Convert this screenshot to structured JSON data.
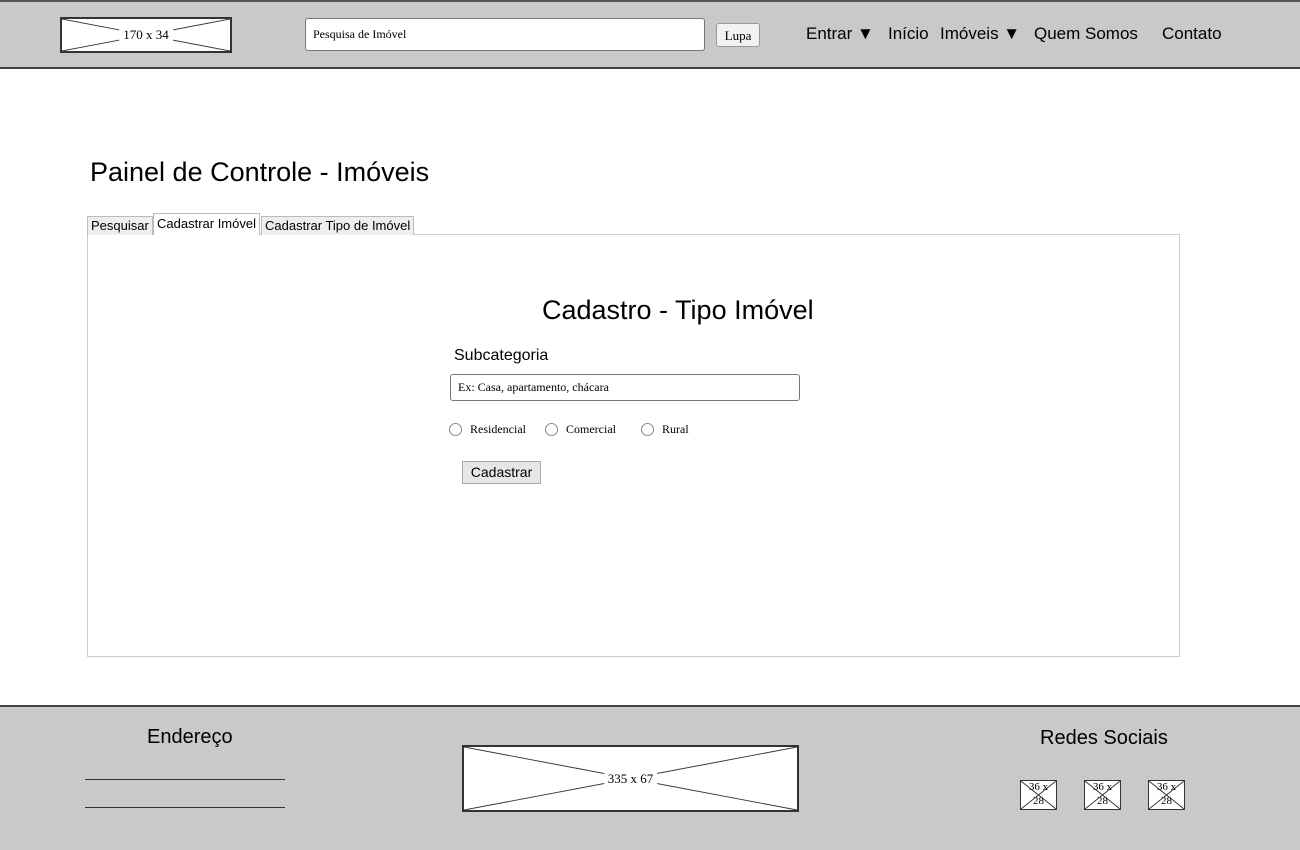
{
  "header": {
    "logo_placeholder": "170 x 34",
    "search": {
      "placeholder": "Pesquisa de Imóvel"
    },
    "search_button": "Lupa",
    "nav": {
      "entrar": "Entrar ▼",
      "inicio": "Início",
      "imoveis": "Imóveis ▼",
      "quem_somos": "Quem Somos",
      "contato": "Contato"
    }
  },
  "main": {
    "page_title": "Painel de Controle - Imóveis",
    "tabs": [
      {
        "label": "Pesquisar",
        "active": false
      },
      {
        "label": "Cadastrar Imóvel",
        "active": true
      },
      {
        "label": "Cadastrar Tipo de Imóvel",
        "active": false
      }
    ],
    "form": {
      "title": "Cadastro - Tipo Imóvel",
      "field_label": "Subcategoria",
      "field_placeholder": "Ex: Casa, apartamento, chácara",
      "radios": [
        "Residencial",
        "Comercial",
        "Rural"
      ],
      "submit_label": "Cadastrar"
    }
  },
  "footer": {
    "address_heading": "Endereço",
    "center_placeholder": "335 x 67",
    "social_heading": "Redes Sociais",
    "social_placeholders": [
      {
        "w": "36 x",
        "h": "28"
      },
      {
        "w": "36 x",
        "h": "28"
      },
      {
        "w": "36 x",
        "h": "28"
      }
    ]
  }
}
